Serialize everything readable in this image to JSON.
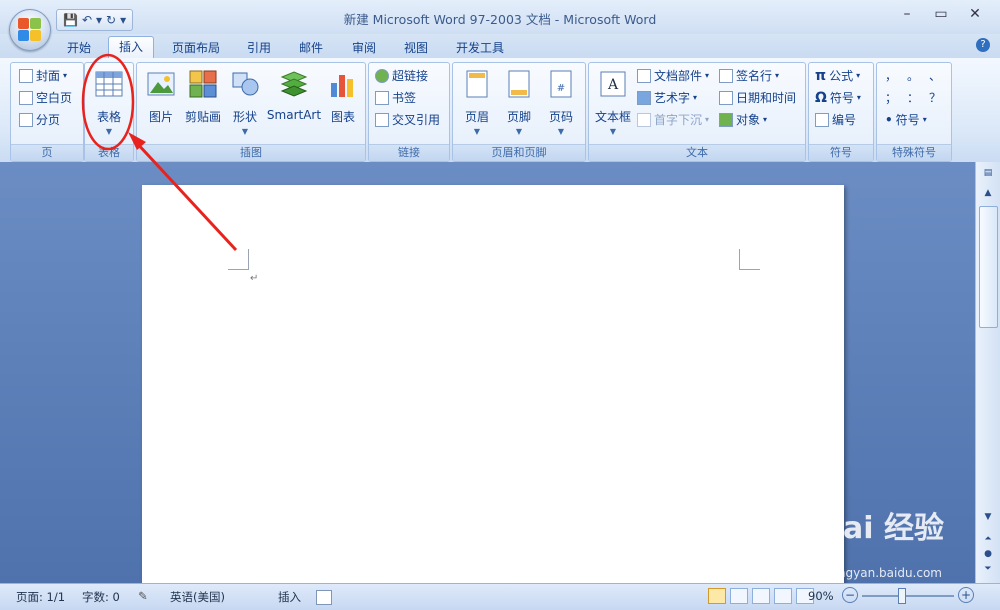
{
  "window": {
    "title": "新建 Microsoft Word 97-2003 文档 - Microsoft Word",
    "minimize": "–",
    "restore": "▭",
    "close": "✕"
  },
  "quick_access": {
    "save": "💾",
    "undo": "↶",
    "undo_dropdown": "▾",
    "redo": "↻",
    "customize": "▾"
  },
  "tabs": [
    {
      "label": "开始",
      "active": false
    },
    {
      "label": "插入",
      "active": true
    },
    {
      "label": "页面布局",
      "active": false
    },
    {
      "label": "引用",
      "active": false
    },
    {
      "label": "邮件",
      "active": false
    },
    {
      "label": "审阅",
      "active": false
    },
    {
      "label": "视图",
      "active": false
    },
    {
      "label": "开发工具",
      "active": false
    }
  ],
  "help": "?",
  "ribbon": {
    "pages": {
      "label": "页",
      "cover": "封面",
      "blank": "空白页",
      "break": "分页"
    },
    "table": {
      "label": "表格",
      "button": "表格"
    },
    "illustrations": {
      "label": "插图",
      "picture": "图片",
      "clipart": "剪贴画",
      "shapes": "形状",
      "smartart": "SmartArt",
      "chart": "图表"
    },
    "links": {
      "label": "链接",
      "hyperlink": "超链接",
      "bookmark": "书签",
      "crossref": "交叉引用"
    },
    "header_footer": {
      "label": "页眉和页脚",
      "header": "页眉",
      "footer": "页脚",
      "page_number": "页码"
    },
    "text": {
      "label": "文本",
      "textbox": "文本框",
      "quickparts": "文档部件",
      "wordart": "艺术字",
      "dropcap": "首字下沉",
      "signature": "签名行",
      "datetime": "日期和时间",
      "object": "对象"
    },
    "symbols": {
      "label": "符号",
      "equation": "公式",
      "symbol": "符号",
      "number": "编号"
    },
    "special": {
      "label": "特殊符号",
      "c1": "，",
      "c2": "。",
      "c3": "、",
      "c4": "；",
      "c5": "：",
      "c6": "？",
      "symbol": "符号"
    }
  },
  "document": {
    "paragraph_mark": "↵"
  },
  "status": {
    "page": "页面: 1/1",
    "words": "字数: 0",
    "language": "英语(美国)",
    "mode": "插入",
    "zoom": "90%"
  },
  "watermark": {
    "brand": "Bai 经验",
    "url": "jingyan.baidu.com"
  },
  "colors": {
    "annotation": "#e8231e",
    "accent": "#15428b"
  }
}
